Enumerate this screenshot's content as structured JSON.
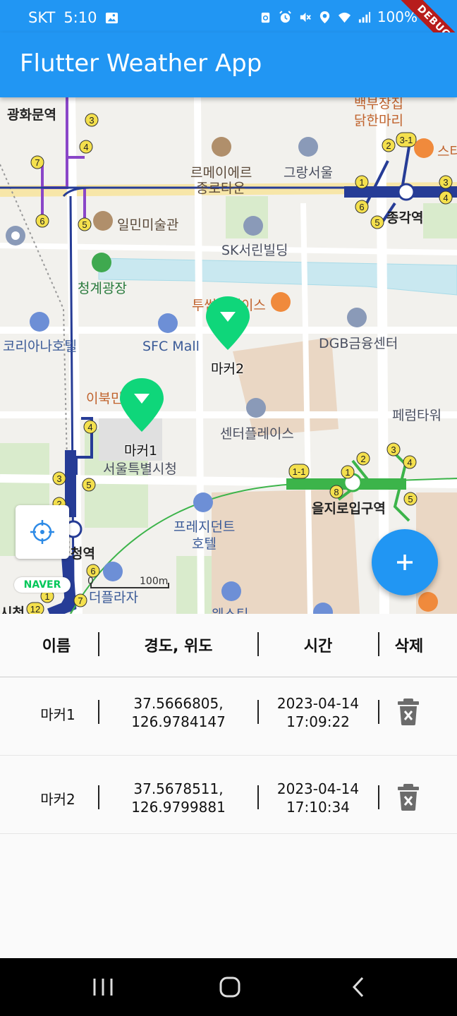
{
  "status_bar": {
    "carrier": "SKT",
    "time": "5:10",
    "battery": "100%",
    "icons": [
      "image-icon",
      "recycle-icon",
      "alarm-icon",
      "mute-icon",
      "location-icon",
      "wifi-icon",
      "signal-icon",
      "battery-icon"
    ]
  },
  "debug_banner": "DEBUG",
  "app_bar": {
    "title": "Flutter Weather App"
  },
  "map": {
    "labels": {
      "gwanghwamun": "광화문역",
      "dongdaemun_top": "백부장집",
      "dakhanmari": "닭한마리",
      "remeier": "르메이에르",
      "jongno_town": "종로타운",
      "grand_seoul": "그랑서울",
      "starbucks": "스타",
      "jonggak": "종각역",
      "ilmin": "일민미술관",
      "sk_building": "SK서린빌딩",
      "cheonggye": "청계광장",
      "tourist": "투썸플레이스",
      "korea_hotel": "코리아나호텔",
      "sfc_mall": "SFC Mall",
      "dgb": "DGB금융센터",
      "ibuk": "이북민",
      "ferrum": "페럼타워",
      "center_place": "센터플레이스",
      "city_hall": "서울특별시청",
      "euljiro": "을지로입구역",
      "president_hotel": "프레지던트",
      "president_hotel2": "호텔",
      "cityhall_station": "청역",
      "plaza": "더플라자",
      "westin": "웨스틴",
      "sicheong": "시청"
    },
    "markers": [
      {
        "label": "마커1"
      },
      {
        "label": "마커2"
      }
    ],
    "naver_logo": "NAVER",
    "scale_zero": "0",
    "scale_label": "100m",
    "locate_button_icon": "crosshair-icon",
    "fab_icon": "plus-icon",
    "colors": {
      "marker": "#0fd67a",
      "line1": "#263c96",
      "line2": "#3cb44a",
      "line5": "#8a46c8",
      "primary": "#2196f3"
    }
  },
  "table": {
    "headers": [
      "이름",
      "경도, 위도",
      "시간",
      "삭제"
    ],
    "rows": [
      {
        "name": "마커1",
        "lat": "37.5666805,",
        "lng": "126.9784147",
        "date": "2023-04-14",
        "time": "17:09:22"
      },
      {
        "name": "마커2",
        "lat": "37.5678511,",
        "lng": "126.9799881",
        "date": "2023-04-14",
        "time": "17:10:34"
      }
    ],
    "delete_icon": "trash-icon"
  },
  "nav_bar": {
    "icons": [
      "recent-apps-icon",
      "home-icon",
      "back-icon"
    ]
  }
}
